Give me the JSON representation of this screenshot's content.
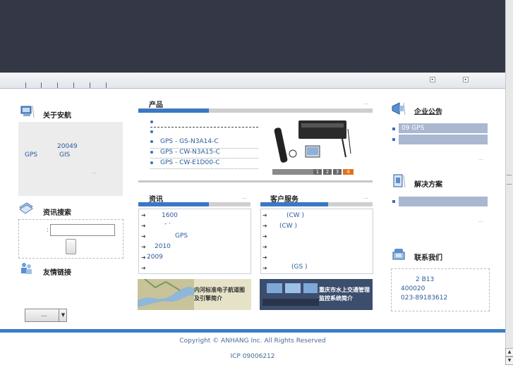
{
  "header": {
    "background": "#343846"
  },
  "sidebar_left": {
    "about": {
      "title": "关于安航",
      "year": "20049",
      "line2_a": "GPS",
      "line2_b": "GIS",
      "more": "..."
    },
    "search": {
      "title": "资讯搜索",
      "colon": ":",
      "input_value": "",
      "button_label": ""
    },
    "links": {
      "title": "友情链接",
      "select_value": "..."
    }
  },
  "products": {
    "title": "产品",
    "more": "...",
    "items": [
      "GPS -   GS-N3A14-C",
      "GPS -   CW-N3A15-C",
      "GPS -   CW-E1D00-C"
    ],
    "pager": [
      "1",
      "2",
      "3",
      "4"
    ],
    "active_page": "4"
  },
  "news": {
    "title": "资讯",
    "more": "...",
    "items": [
      "1600",
      "-   ·",
      "GPS",
      "2010",
      "2009",
      ""
    ]
  },
  "service": {
    "title": "客户服务",
    "more": "...",
    "items": [
      "(CW )",
      "(CW )",
      "",
      "",
      "",
      "(GS )"
    ]
  },
  "banners": {
    "left_text": "内河标准电子航道图\n及引擎简介",
    "right_text": "重庆市水上交通管理\n监控系统简介"
  },
  "sidebar_right": {
    "notice": {
      "title": "企业公告",
      "item1": "09   GPS",
      "item2": "",
      "more": "..."
    },
    "solutions": {
      "title": "解决方案",
      "item1": "",
      "more": "..."
    },
    "contact": {
      "title": "联系我们",
      "line1": "2     B13",
      "line2": "400020",
      "line3": "023-89183612"
    }
  },
  "footer": {
    "copyright": "Copyright © ANHANG Inc. All Rights Reserved",
    "icp": "ICP 09006212"
  },
  "colors": {
    "accent": "#3a78c4",
    "footer_line": "#3a7cc8",
    "link": "#2a5a9a"
  }
}
